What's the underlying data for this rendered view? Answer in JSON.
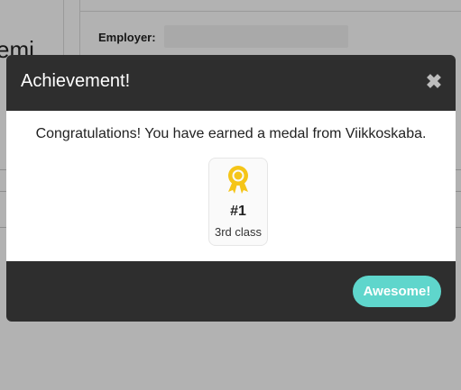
{
  "background": {
    "partial_heading": "emi",
    "employer_label": "Employer:",
    "employer_value": ""
  },
  "modal": {
    "title": "Achievement!",
    "close_icon": "close-icon",
    "message": "Congratulations! You have earned a medal from Viikkoskaba.",
    "medal": {
      "icon": "medal-icon",
      "rank": "#1",
      "class_label": "3rd class",
      "color": "#f5c518"
    },
    "awesome_button_label": "Awesome!"
  },
  "colors": {
    "modal_bg": "#2e2e2e",
    "button_accent": "#5fd6cc"
  }
}
